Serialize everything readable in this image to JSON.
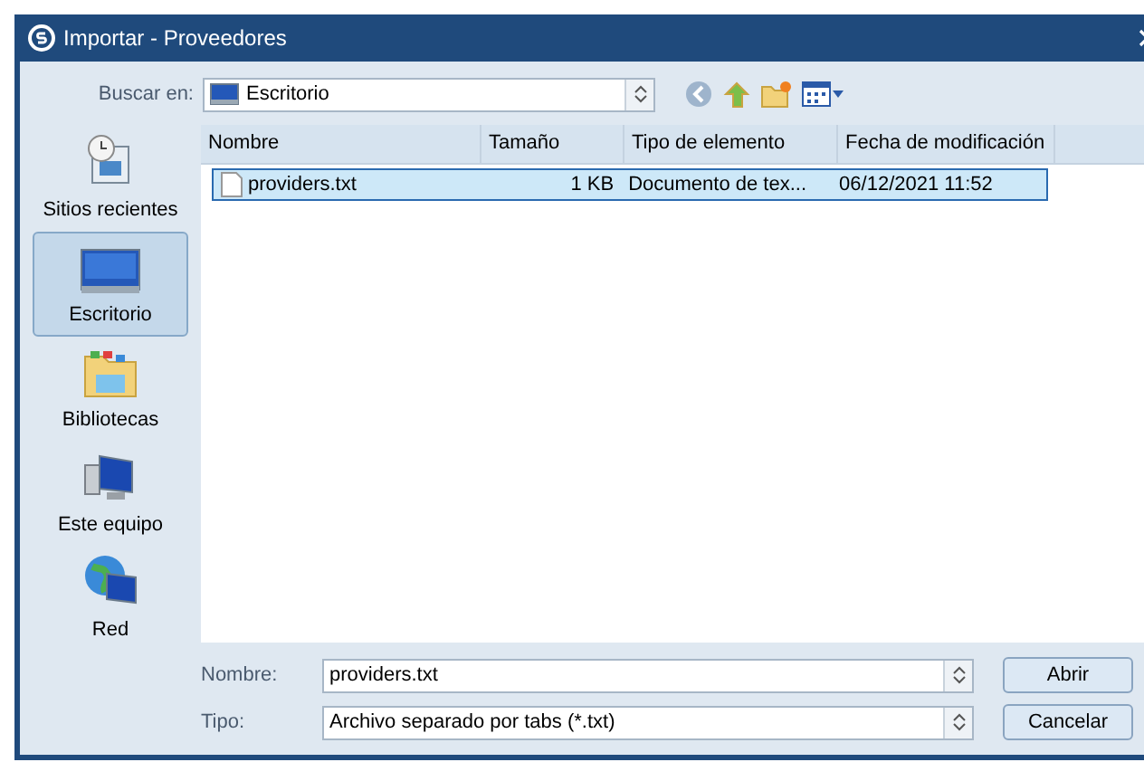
{
  "window": {
    "title": "Importar - Proveedores"
  },
  "look_in": {
    "label": "Buscar en:",
    "value": "Escritorio"
  },
  "sidebar": {
    "items": [
      {
        "label": "Sitios recientes",
        "kind": "recent",
        "selected": false
      },
      {
        "label": "Escritorio",
        "kind": "desktop",
        "selected": true
      },
      {
        "label": "Bibliotecas",
        "kind": "libraries",
        "selected": false
      },
      {
        "label": "Este equipo",
        "kind": "computer",
        "selected": false
      },
      {
        "label": "Red",
        "kind": "network",
        "selected": false
      }
    ]
  },
  "table": {
    "columns": [
      "Nombre",
      "Tamaño",
      "Tipo de elemento",
      "Fecha de modificación"
    ],
    "rows": [
      {
        "cells": [
          "providers.txt",
          "1 KB",
          "Documento de tex...",
          "06/12/2021 11:52"
        ],
        "selected": true
      }
    ]
  },
  "filename": {
    "label": "Nombre:",
    "value": "providers.txt"
  },
  "filetype": {
    "label": "Tipo:",
    "value": "Archivo separado por tabs (*.txt)"
  },
  "buttons": [
    "Abrir",
    "Cancelar"
  ]
}
